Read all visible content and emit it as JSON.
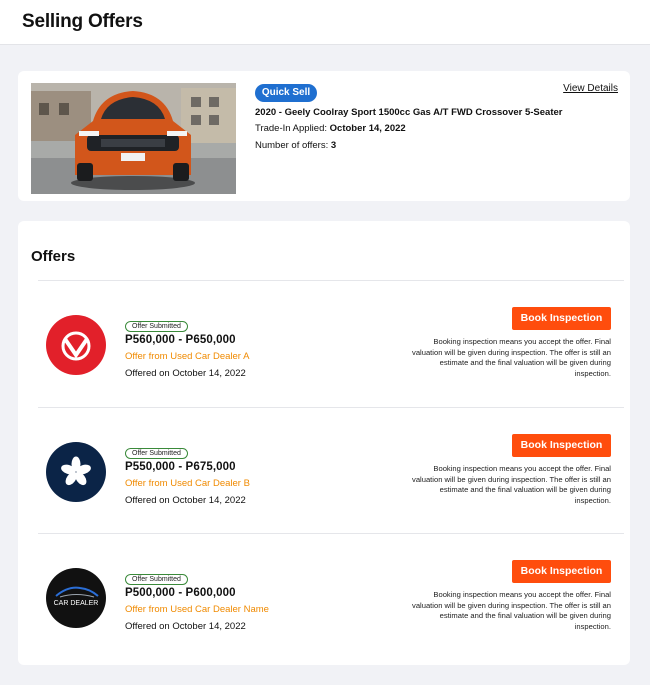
{
  "page": {
    "title": "Selling Offers"
  },
  "vehicle": {
    "badge": "Quick Sell",
    "view_details": "View Details",
    "name": "2020 - Geely Coolray Sport 1500cc Gas A/T FWD Crossover 5-Seater",
    "trade_in_label": "Trade-In Applied:",
    "trade_in_date": "October 14, 2022",
    "offers_label": "Number of offers:",
    "offers_count": "3",
    "photo_icon": "car-photo"
  },
  "offers": {
    "heading": "Offers",
    "items": [
      {
        "status": "Offer Submitted",
        "price": "P560,000 - P650,000",
        "dealer": "Offer from Used Car Dealer A",
        "offered_on": "Offered on October 14, 2022",
        "button": "Book Inspection",
        "disclaimer": "Booking inspection means you accept the offer. Final valuation will be given during inspection. The offer is still an estimate and the final valuation will be given during inspection.",
        "logo_icon": "v-logo-icon",
        "logo_color": "#e2202a"
      },
      {
        "status": "Offer Submitted",
        "price": "P550,000 - P675,000",
        "dealer": "Offer from Used Car Dealer B",
        "offered_on": "Offered on October 14, 2022",
        "button": "Book Inspection",
        "disclaimer": "Booking inspection means you accept the offer. Final valuation will be given during inspection. The offer is still an estimate and the final valuation will be given during inspection.",
        "logo_icon": "asterisk-logo-icon",
        "logo_color": "#0b2447"
      },
      {
        "status": "Offer Submitted",
        "price": "P500,000 - P600,000",
        "dealer": "Offer from Used Car Dealer Name",
        "offered_on": "Offered on October 14, 2022",
        "button": "Book Inspection",
        "disclaimer": "Booking inspection means you accept the offer. Final valuation will be given during inspection. The offer is still an estimate and the final valuation will be given during inspection.",
        "logo_icon": "car-dealer-logo-icon",
        "logo_color": "#111111",
        "logo_text": "CAR DEALER"
      }
    ]
  },
  "colors": {
    "accent": "#ff4d0d",
    "badge_blue": "#1f6fd0",
    "dealer_orange": "#f08a00"
  }
}
